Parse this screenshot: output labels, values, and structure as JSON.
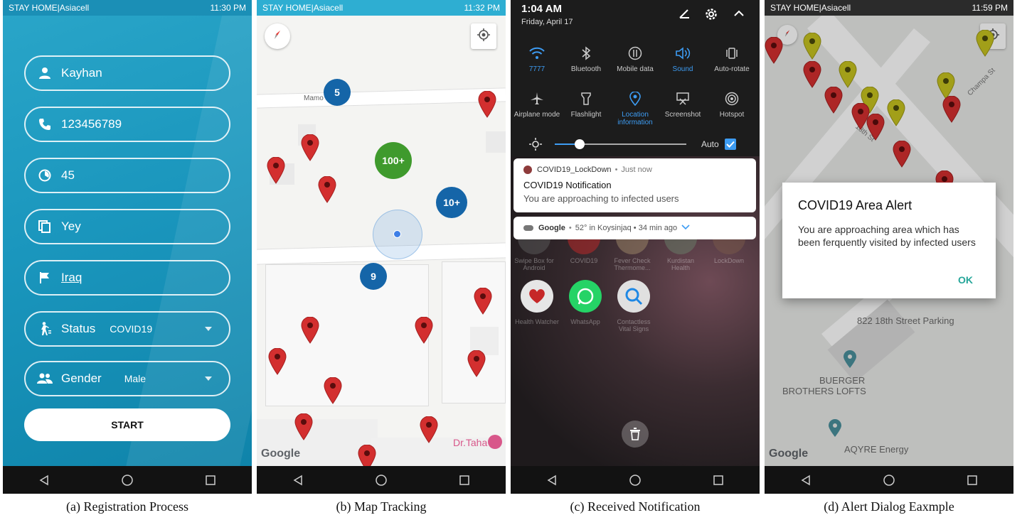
{
  "panel_a": {
    "status_carrier": "STAY HOME|Asiacell",
    "status_time": "11:30 PM",
    "name": "Kayhan",
    "phone": "123456789",
    "age": "45",
    "answer": "Yey",
    "country": "Iraq",
    "status_label": "Status",
    "status_value": "COVID19",
    "gender_label": "Gender",
    "gender_value": "Male",
    "start_label": "START",
    "caption": "(a) Registration Process"
  },
  "panel_b": {
    "status_carrier": "STAY HOME|Asiacell",
    "status_time": "11:32 PM",
    "street_label": "Mamo        d",
    "cluster_5": "5",
    "cluster_100": "100+",
    "cluster_10": "10+",
    "cluster_9": "9",
    "place_label": "Dr.Taha",
    "google": "Google",
    "caption": "(b) Map Tracking"
  },
  "panel_c": {
    "time": "1:04 AM",
    "date": "Friday, April 17",
    "tiles": [
      {
        "label": "7777"
      },
      {
        "label": "Bluetooth"
      },
      {
        "label": "Mobile data"
      },
      {
        "label": "Sound"
      },
      {
        "label": "Auto-rotate"
      },
      {
        "label": "Airplane mode"
      },
      {
        "label": "Flashlight"
      },
      {
        "label": "Location information"
      },
      {
        "label": "Screenshot"
      },
      {
        "label": "Hotspot"
      }
    ],
    "brightness_auto": "Auto",
    "notif_app": "COVID19_LockDown",
    "notif_time": "Just now",
    "notif_title": "COVID19 Notification",
    "notif_text": "You are approaching to infected users",
    "google_notif": "Google",
    "google_notif_detail": "52° in Koysinjaq • 34 min ago",
    "apps": [
      {
        "label": "Swipe Box for Android"
      },
      {
        "label": "COVID19"
      },
      {
        "label": "Fever Check Thermome..."
      },
      {
        "label": "Kurdistan Health"
      },
      {
        "label": "LockDown"
      },
      {
        "label": "Health Watcher"
      },
      {
        "label": "WhatsApp"
      },
      {
        "label": "Contactless Vital Signs"
      }
    ],
    "caption": "(c) Received Notification"
  },
  "panel_d": {
    "status_carrier": "STAY HOME|Asiacell",
    "status_time": "11:59 PM",
    "street_champa": "Champa St",
    "street_18th": "18th St",
    "dialog_title": "COVID19 Area Alert",
    "dialog_text": "You are approaching area which has been ferquently visited by infected users",
    "dialog_ok": "OK",
    "poi_parking": "822 18th Street Parking",
    "poi_lofts_1": "BUERGER",
    "poi_lofts_2": "BROTHERS LOFTS",
    "poi_aqyre": "AQYRE Energy",
    "google": "Google",
    "caption": "(d) Alert Dialog Eaxmple"
  },
  "colors": {
    "teal_bg": "#1a96bd",
    "pin_red": "#d32f2f",
    "pin_yellow": "#c6c21f",
    "cluster_blue": "#1565a8",
    "cluster_green": "#3f9a2d",
    "accent_blue": "#3d9cf3",
    "ok_teal": "#26a69a"
  }
}
